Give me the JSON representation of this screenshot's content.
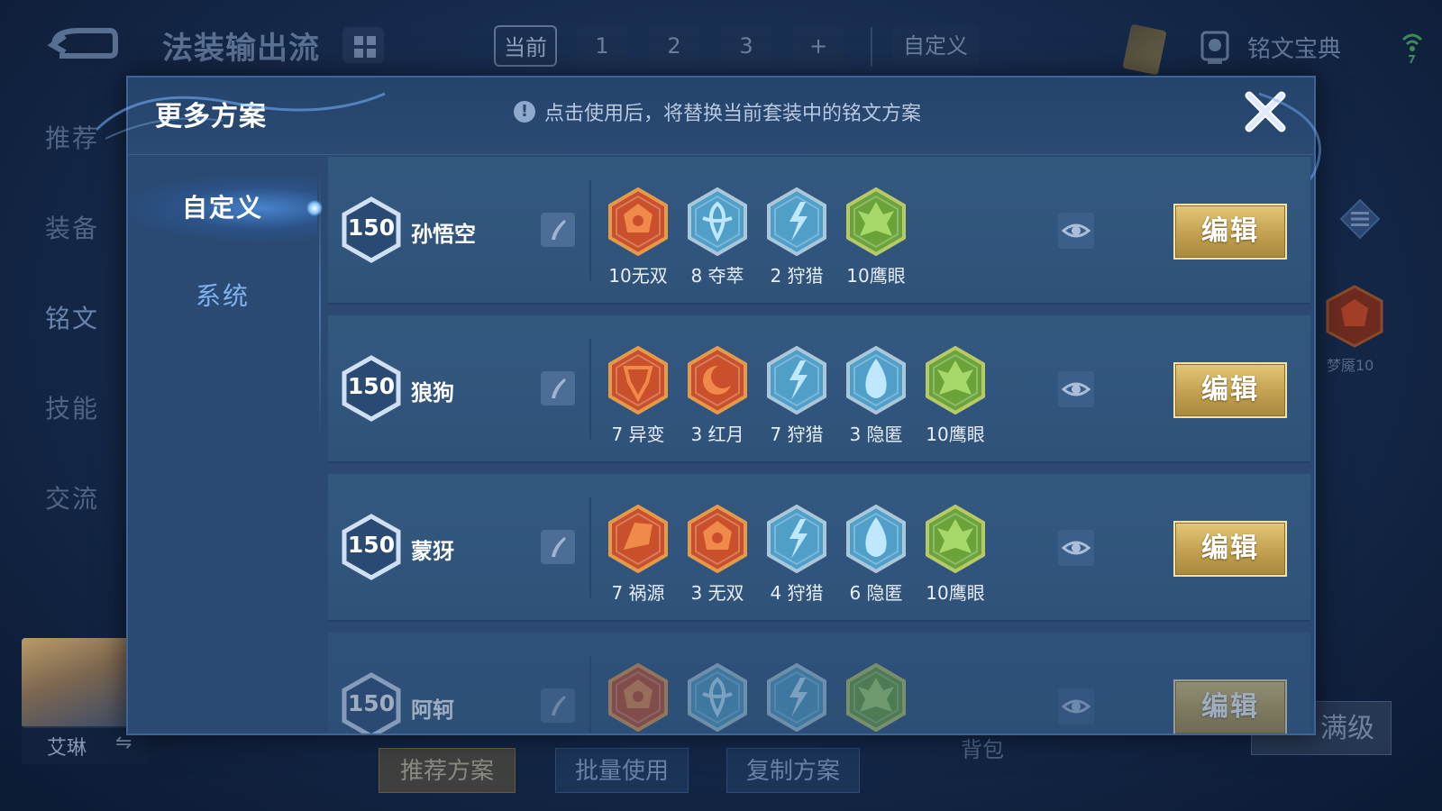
{
  "background": {
    "page_title": "法装输出流",
    "tabs": [
      "当前",
      "1",
      "2",
      "3",
      "+"
    ],
    "custom_tab": "自定义",
    "rune_book": "铭文宝典",
    "side_menu": [
      "推荐",
      "装备",
      "铭文",
      "技能",
      "交流"
    ],
    "hero_name": "艾琳",
    "rune_level_label": "梦魇10",
    "bottom_buttons": [
      "推荐方案",
      "批量使用",
      "复制方案"
    ],
    "bag_label": "背包",
    "max_level_label": "满级"
  },
  "modal": {
    "title": "更多方案",
    "notice": "点击使用后，将替换当前套装中的铭文方案",
    "nav": {
      "active": "自定义",
      "inactive": "系统"
    },
    "edit_label": "编辑",
    "plans": [
      {
        "level": "150",
        "name": "孙悟空",
        "runes": [
          {
            "label": "10无双",
            "icon": "rune-wushuang-red-icon"
          },
          {
            "label": "8 夺萃",
            "icon": "rune-duocui-blue-icon"
          },
          {
            "label": "2 狩猎",
            "icon": "rune-shoulie-blue-icon"
          },
          {
            "label": "10鹰眼",
            "icon": "rune-yingyan-green-icon"
          }
        ]
      },
      {
        "level": "150",
        "name": "狼狗",
        "runes": [
          {
            "label": "7 异变",
            "icon": "rune-yibian-red-icon"
          },
          {
            "label": "3 红月",
            "icon": "rune-hongyue-red-icon"
          },
          {
            "label": "7 狩猎",
            "icon": "rune-shoulie-blue-icon"
          },
          {
            "label": "3 隐匿",
            "icon": "rune-yinni-blue-icon"
          },
          {
            "label": "10鹰眼",
            "icon": "rune-yingyan-green-icon"
          }
        ]
      },
      {
        "level": "150",
        "name": "蒙犽",
        "runes": [
          {
            "label": "7 祸源",
            "icon": "rune-huoyuan-red-icon"
          },
          {
            "label": "3 无双",
            "icon": "rune-wushuang-red-icon"
          },
          {
            "label": "4 狩猎",
            "icon": "rune-shoulie-blue-icon"
          },
          {
            "label": "6 隐匿",
            "icon": "rune-yinni-blue-icon"
          },
          {
            "label": "10鹰眼",
            "icon": "rune-yingyan-green-icon"
          }
        ]
      },
      {
        "level": "150",
        "name": "阿轲",
        "runes": [
          {
            "label": "",
            "icon": "rune-wushuang-red-icon"
          },
          {
            "label": "",
            "icon": "rune-duocui-blue-icon"
          },
          {
            "label": "",
            "icon": "rune-shoulie-blue-icon"
          },
          {
            "label": "",
            "icon": "rune-yingyan-green-icon"
          }
        ]
      }
    ]
  },
  "colors": {
    "red_rune": "#c9502a",
    "blue_rune": "#4f9fc8",
    "green_rune": "#6aa33a",
    "gold_button": "#c6a453",
    "panel": "#2a4a73"
  }
}
